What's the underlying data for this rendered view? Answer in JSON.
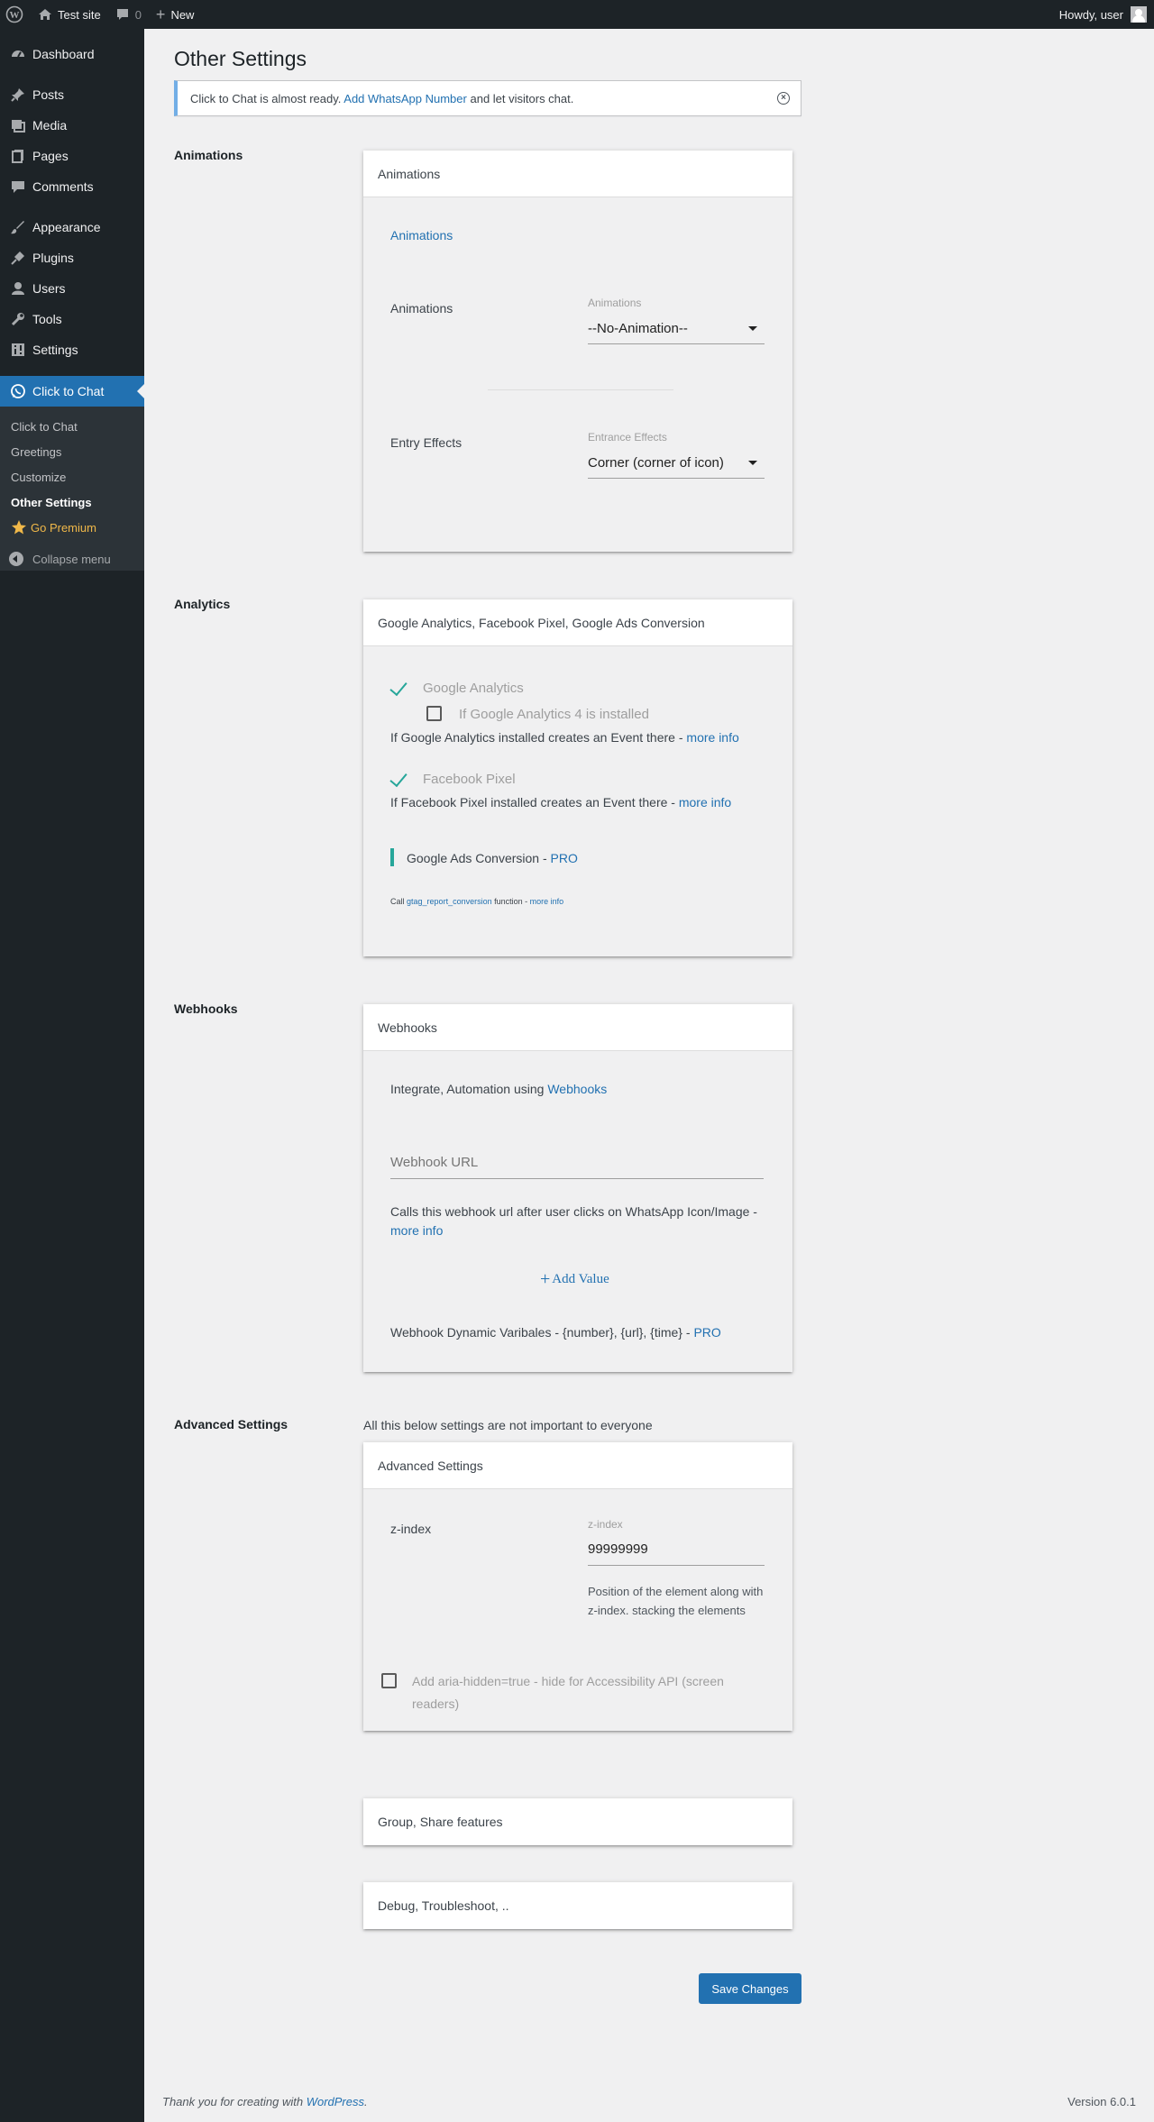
{
  "adminbar": {
    "site_name": "Test site",
    "comments_count": "0",
    "new_label": "New",
    "howdy": "Howdy, user"
  },
  "sidebar": {
    "items": [
      {
        "label": "Dashboard",
        "icon": "dashboard-icon"
      },
      {
        "label": "Posts",
        "icon": "pin-icon"
      },
      {
        "label": "Media",
        "icon": "media-icon"
      },
      {
        "label": "Pages",
        "icon": "pages-icon"
      },
      {
        "label": "Comments",
        "icon": "comment-icon"
      },
      {
        "label": "Appearance",
        "icon": "brush-icon"
      },
      {
        "label": "Plugins",
        "icon": "plug-icon"
      },
      {
        "label": "Users",
        "icon": "user-icon"
      },
      {
        "label": "Tools",
        "icon": "wrench-icon"
      },
      {
        "label": "Settings",
        "icon": "settings-icon"
      },
      {
        "label": "Click to Chat",
        "icon": "whatsapp-icon"
      }
    ],
    "submenu": [
      "Click to Chat",
      "Greetings",
      "Customize",
      "Other Settings",
      "Go Premium"
    ],
    "collapse": "Collapse menu"
  },
  "page": {
    "title": "Other Settings",
    "notice": {
      "before": "Click to Chat is almost ready.",
      "link": "Add WhatsApp Number",
      "after": "and let visitors chat."
    }
  },
  "animations": {
    "section_label": "Animations",
    "card_title": "Animations",
    "link": "Animations",
    "row1_label": "Animations",
    "row1_small": "Animations",
    "row1_value": "--No-Animation--",
    "row2_label": "Entry Effects",
    "row2_small": "Entrance Effects",
    "row2_value": "Corner (corner of icon)"
  },
  "analytics": {
    "section_label": "Analytics",
    "card_title": "Google Analytics, Facebook Pixel, Google Ads Conversion",
    "ga_label": "Google Analytics",
    "ga4_label": "If Google Analytics 4 is installed",
    "ga_desc": "If Google Analytics installed creates an Event there -",
    "more_info": "more info",
    "fb_label": "Facebook Pixel",
    "fb_desc": "If Facebook Pixel installed creates an Event there -",
    "gads_label": "Google Ads Conversion -",
    "pro": "PRO",
    "call_prefix": "Call",
    "call_func": "gtag_report_conversion",
    "call_suffix": "function -"
  },
  "webhooks": {
    "section_label": "Webhooks",
    "card_title": "Webhooks",
    "intro": "Integrate, Automation using",
    "intro_link": "Webhooks",
    "url_placeholder": "Webhook URL",
    "desc": "Calls this webhook url after user clicks on WhatsApp Icon/Image -",
    "more_info": "more info",
    "add_value": "Add Value",
    "dyn_vars": "Webhook Dynamic Varibales - {number}, {url}, {time} -",
    "pro": "PRO"
  },
  "advanced": {
    "section_label": "Advanced Settings",
    "intro": "All this below settings are not important to everyone",
    "card_title": "Advanced Settings",
    "zindex_label": "z-index",
    "zindex_small": "z-index",
    "zindex_value": "99999999",
    "zindex_desc": "Position of the element along with z-index. stacking the elements",
    "aria_label": "Add aria-hidden=true - hide for Accessibility API (screen readers)"
  },
  "collapsed_cards": [
    "Group, Share features",
    "Debug, Troubleshoot, .."
  ],
  "save_label": "Save Changes",
  "footer": {
    "thanks": "Thank you for creating with",
    "wp_link": "WordPress",
    "period": ".",
    "version": "Version 6.0.1"
  }
}
